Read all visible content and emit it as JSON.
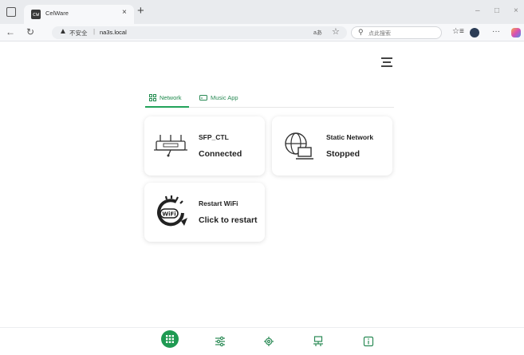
{
  "browser": {
    "tab_title": "CelWare",
    "tab_favicon_text": "cw",
    "close_glyph": "×",
    "new_tab_glyph": "+",
    "address": {
      "insecure_label": "不安全",
      "separator": "|",
      "url": "na3s.local",
      "reader_label": "aあ"
    },
    "search": {
      "placeholder": "点此搜索"
    },
    "window_controls": {
      "minimize": "–",
      "maximize": "□",
      "close": "×"
    },
    "menu_glyph": "···"
  },
  "app": {
    "tabs": [
      {
        "label": "Network",
        "icon": "network-grid-icon",
        "active": true
      },
      {
        "label": "Music App",
        "icon": "screen-cast-icon",
        "active": false
      }
    ],
    "cards": [
      {
        "title": "SFP_CTL",
        "status": "Connected",
        "icon": "router-icon"
      },
      {
        "title": "Static Network",
        "status": "Stopped",
        "icon": "globe-monitor-icon"
      },
      {
        "title": "Restart WiFi",
        "status": "Click to restart",
        "icon": "wifi-restart-icon"
      }
    ],
    "bottom_nav": [
      {
        "name": "home",
        "icon": "grid-dots-icon",
        "active": true
      },
      {
        "name": "settings-sliders",
        "icon": "sliders-icon",
        "active": false
      },
      {
        "name": "settings",
        "icon": "gear-icon",
        "active": false
      },
      {
        "name": "network",
        "icon": "lan-icon",
        "active": false
      },
      {
        "name": "info",
        "icon": "info-icon",
        "active": false
      }
    ],
    "colors": {
      "accent": "#1f9a52",
      "card_bg": "#ffffff",
      "text": "#222222"
    }
  }
}
